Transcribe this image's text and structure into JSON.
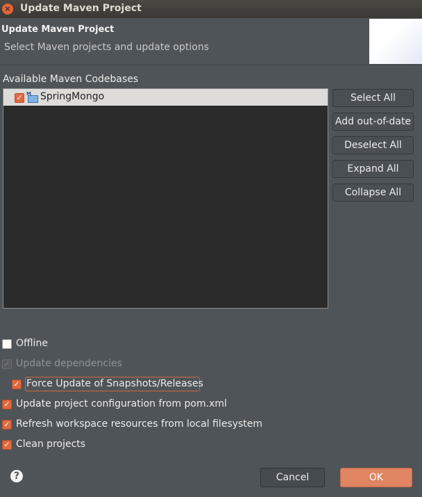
{
  "window": {
    "title": "Update Maven Project"
  },
  "header": {
    "title": "Update Maven Project",
    "subtitle": "Select Maven projects and update options"
  },
  "codebases": {
    "label": "Available Maven Codebases",
    "items": [
      {
        "name": "SpringMongo",
        "checked": true,
        "icon": "maven-folder-icon"
      }
    ]
  },
  "side_buttons": [
    "Select All",
    "Add out-of-date",
    "Deselect All",
    "Expand All",
    "Collapse All"
  ],
  "options": [
    {
      "label": "Offline",
      "checked": false,
      "enabled": true
    },
    {
      "label": "Update dependencies",
      "checked": true,
      "enabled": false
    },
    {
      "label": "Force Update of Snapshots/Releases",
      "checked": true,
      "enabled": true,
      "focused": true
    },
    {
      "label": "Update project configuration from pom.xml",
      "checked": true,
      "enabled": true
    },
    {
      "label": "Refresh workspace resources from local filesystem",
      "checked": true,
      "enabled": true
    },
    {
      "label": "Clean projects",
      "checked": true,
      "enabled": true
    }
  ],
  "footer": {
    "cancel": "Cancel",
    "ok": "OK"
  },
  "colors": {
    "accent": "#e08462",
    "background": "#4f5458",
    "tree_bg": "#2b2b2b"
  }
}
